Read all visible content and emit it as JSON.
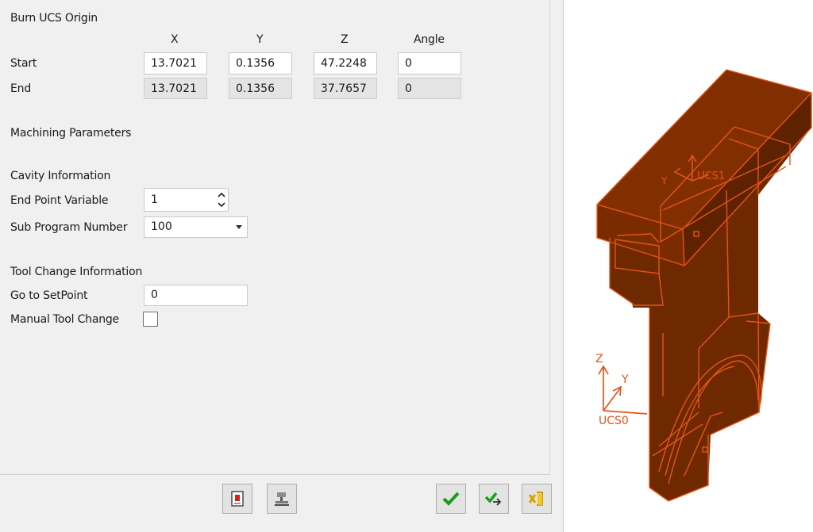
{
  "burn_ucs": {
    "title": "Burn UCS Origin",
    "columns": [
      "X",
      "Y",
      "Z",
      "Angle"
    ],
    "start": {
      "label": "Start",
      "x": "13.7021",
      "y": "0.1356",
      "z": "47.2248",
      "angle": "0"
    },
    "end": {
      "label": "End",
      "x": "13.7021",
      "y": "0.1356",
      "z": "37.7657",
      "angle": "0"
    }
  },
  "machining": {
    "title": "Machining Parameters"
  },
  "cavity": {
    "title": "Cavity Information",
    "end_point_label": "End Point Variable",
    "end_point_value": "1",
    "sub_program_label": "Sub Program Number",
    "sub_program_value": "100"
  },
  "tool_change": {
    "title": "Tool Change Information",
    "setpoint_label": "Go to SetPoint",
    "setpoint_value": "0",
    "manual_label": "Manual Tool Change",
    "manual_checked": false
  },
  "viewport": {
    "model_color": "#6e2900",
    "edge_color": "#e4541a",
    "ucs1_label": "UCS1",
    "ucs1_y": "Y",
    "ucs0_z": "Z",
    "ucs0_y": "Y",
    "ucs0_label": "UCS0"
  },
  "icons": [
    "document-icon",
    "machine-icon",
    "ok-check-icon",
    "apply-check-icon",
    "cancel-exit-icon"
  ]
}
